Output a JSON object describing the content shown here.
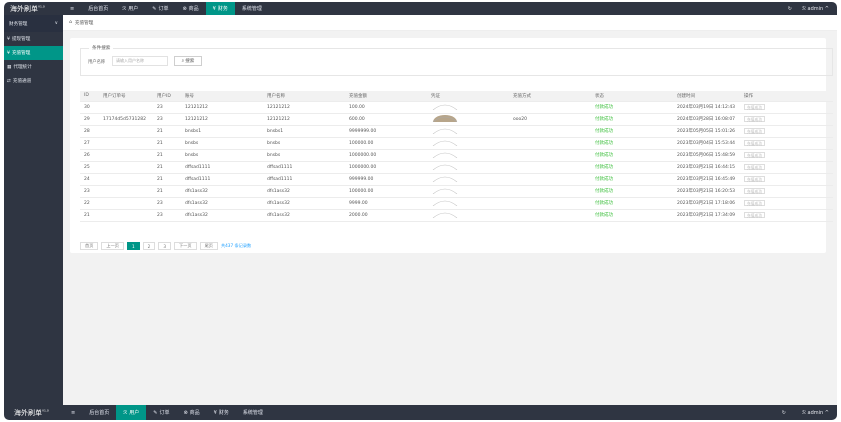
{
  "top": {
    "brand": "海外刷单",
    "brand_sup": "V1.0",
    "nav": [
      {
        "icon": "≡",
        "label": ""
      },
      {
        "icon": "",
        "label": "后台首页"
      },
      {
        "icon": "ℛ",
        "label": "用户"
      },
      {
        "icon": "✎",
        "label": "订单"
      },
      {
        "icon": "⊗",
        "label": "商品"
      },
      {
        "icon": "¥",
        "label": "财务"
      },
      {
        "icon": "",
        "label": "系统管理"
      }
    ],
    "refresh": "↻",
    "user": "admin",
    "user_icon": "ℛ",
    "chevron": "^"
  },
  "sidebar": {
    "title": "财务管理",
    "chevron": "∨",
    "items": [
      {
        "icon": "¥",
        "label": "提现管理"
      },
      {
        "icon": "¥",
        "label": "充值管理"
      },
      {
        "icon": "▦",
        "label": "代理统计"
      },
      {
        "icon": "⇄",
        "label": "充值通道"
      }
    ]
  },
  "tab": {
    "home": "⌂",
    "label": "充值管理"
  },
  "filter": {
    "legend": "条件搜索",
    "label": "用户名称",
    "placeholder": "请输入用户名称",
    "button": "搜索",
    "button_icon": "⌕"
  },
  "table": {
    "headers": [
      "ID",
      "用户订单号",
      "用户ID",
      "账号",
      "用户名称",
      "充值金额",
      "凭证",
      "充值方式",
      "状态",
      "创建时间",
      "操作"
    ],
    "rows": [
      [
        "30",
        "",
        "23",
        "12121212",
        "12121212",
        "100.00",
        "img",
        "",
        "付款成功",
        "2024年03月19日 14:12:43",
        "充值成功"
      ],
      [
        "29",
        "17174d5d5731282",
        "23",
        "12121212",
        "12121212",
        "600.00",
        "img",
        "ooo20",
        "付款成功",
        "2024年03月28日 16:08:07",
        "充值成功"
      ],
      [
        "28",
        "",
        "21",
        "bnsbs1",
        "bnsbs1",
        "9999999.00",
        "img",
        "",
        "付款成功",
        "2023年05月05日 15:01:26",
        "充值成功"
      ],
      [
        "27",
        "",
        "21",
        "bnsbs",
        "bnsbs",
        "100000.00",
        "img",
        "",
        "付款成功",
        "2023年03月04日 15:53:44",
        "充值成功"
      ],
      [
        "26",
        "",
        "21",
        "bnsbs",
        "bnsbs",
        "1000000.00",
        "img",
        "",
        "付款成功",
        "2023年05月06日 15:48:59",
        "充值成功"
      ],
      [
        "25",
        "",
        "21",
        "dffsad1111",
        "dffsad1111",
        "1000000.00",
        "img",
        "",
        "付款成功",
        "2023年03月21日 16:44:15",
        "充值成功"
      ],
      [
        "24",
        "",
        "21",
        "dffsad1111",
        "dffsad1111",
        "999999.00",
        "img",
        "",
        "付款成功",
        "2023年03月21日 16:45:49",
        "充值成功"
      ],
      [
        "23",
        "",
        "21",
        "dfs1ass32",
        "dfs1ass32",
        "100000.00",
        "img",
        "",
        "付款成功",
        "2023年03月21日 16:20:53",
        "充值成功"
      ],
      [
        "22",
        "",
        "23",
        "dfs1ass32",
        "dfs1ass32",
        "9999.00",
        "img",
        "",
        "付款成功",
        "2023年03月21日 17:18:06",
        "充值成功"
      ],
      [
        "21",
        "",
        "23",
        "dfs1ass32",
        "dfs1ass32",
        "2000.00",
        "img",
        "",
        "付款成功",
        "2023年03月21日 17:34:09",
        "充值成功"
      ]
    ]
  },
  "pagination": {
    "first": "首页",
    "prev": "上一页",
    "pages": [
      "1",
      "2",
      "3"
    ],
    "next": "下一页",
    "last": "尾页",
    "total": "共437 条记录数"
  },
  "bottom": {
    "brand": "海外刷单",
    "brand_sup": "V1.0",
    "nav": [
      {
        "icon": "≡",
        "label": ""
      },
      {
        "icon": "",
        "label": "后台首页"
      },
      {
        "icon": "ℛ",
        "label": "用户"
      },
      {
        "icon": "✎",
        "label": "订单"
      },
      {
        "icon": "⊗",
        "label": "商品"
      },
      {
        "icon": "¥",
        "label": "财务"
      },
      {
        "icon": "",
        "label": "系统管理"
      }
    ],
    "refresh": "↻",
    "user": "admin",
    "user_icon": "ℛ",
    "chevron": "^"
  },
  "colors": {
    "accent": "#009688",
    "topbar": "#2f3542",
    "success": "#3bbf3b"
  }
}
